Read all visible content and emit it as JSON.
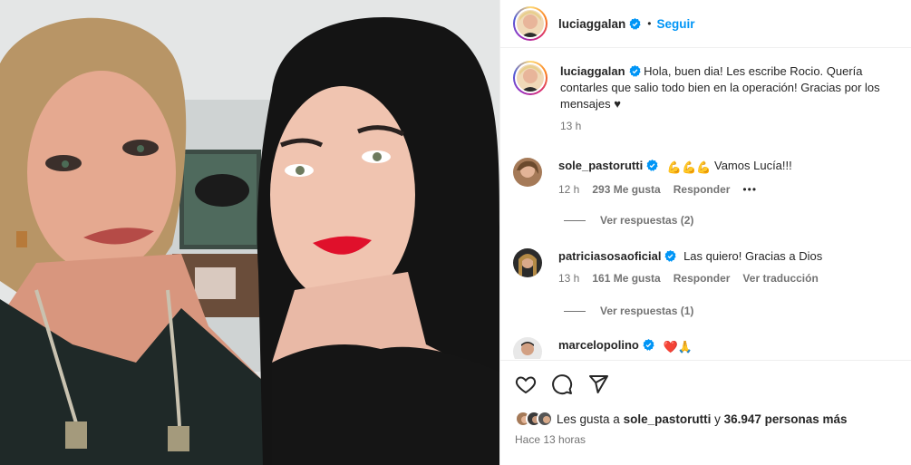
{
  "post": {
    "author": "luciaggalan",
    "dot": "•",
    "follow_label": "Seguir"
  },
  "caption": {
    "author": "luciaggalan",
    "text": "Hola, buen dia! Les escribe Rocio. Quería contarles que salio todo bien en la operación! Gracias por los mensajes ♥",
    "time": "13 h"
  },
  "comments": [
    {
      "user": "sole_pastorutti",
      "text": "Vamos Lucía!!!",
      "emoji": "💪💪💪",
      "time": "12 h",
      "likes": "293 Me gusta",
      "reply": "Responder",
      "more": "•••",
      "replies": "Ver respuestas (2)"
    },
    {
      "user": "patriciasosaoficial",
      "text": "Las quiero! Gracias a Dios",
      "time": "13 h",
      "likes": "161 Me gusta",
      "reply": "Responder",
      "translate": "Ver traducción",
      "replies": "Ver respuestas (1)"
    },
    {
      "user": "marcelopolino",
      "emoji": "❤️🙏"
    }
  ],
  "footer": {
    "likes_prefix": "Les gusta a",
    "likes_user": "sole_pastorutti",
    "likes_mid": "y",
    "likes_count": "36.947 personas más",
    "posted": "Hace 13 horas"
  },
  "icons": [
    "heart-icon",
    "comment-icon",
    "share-icon",
    "verified-icon",
    "more-icon"
  ],
  "colors": {
    "accent": "#0095f6",
    "text": "#262626",
    "muted": "#737373",
    "verified": "#0095f6"
  }
}
